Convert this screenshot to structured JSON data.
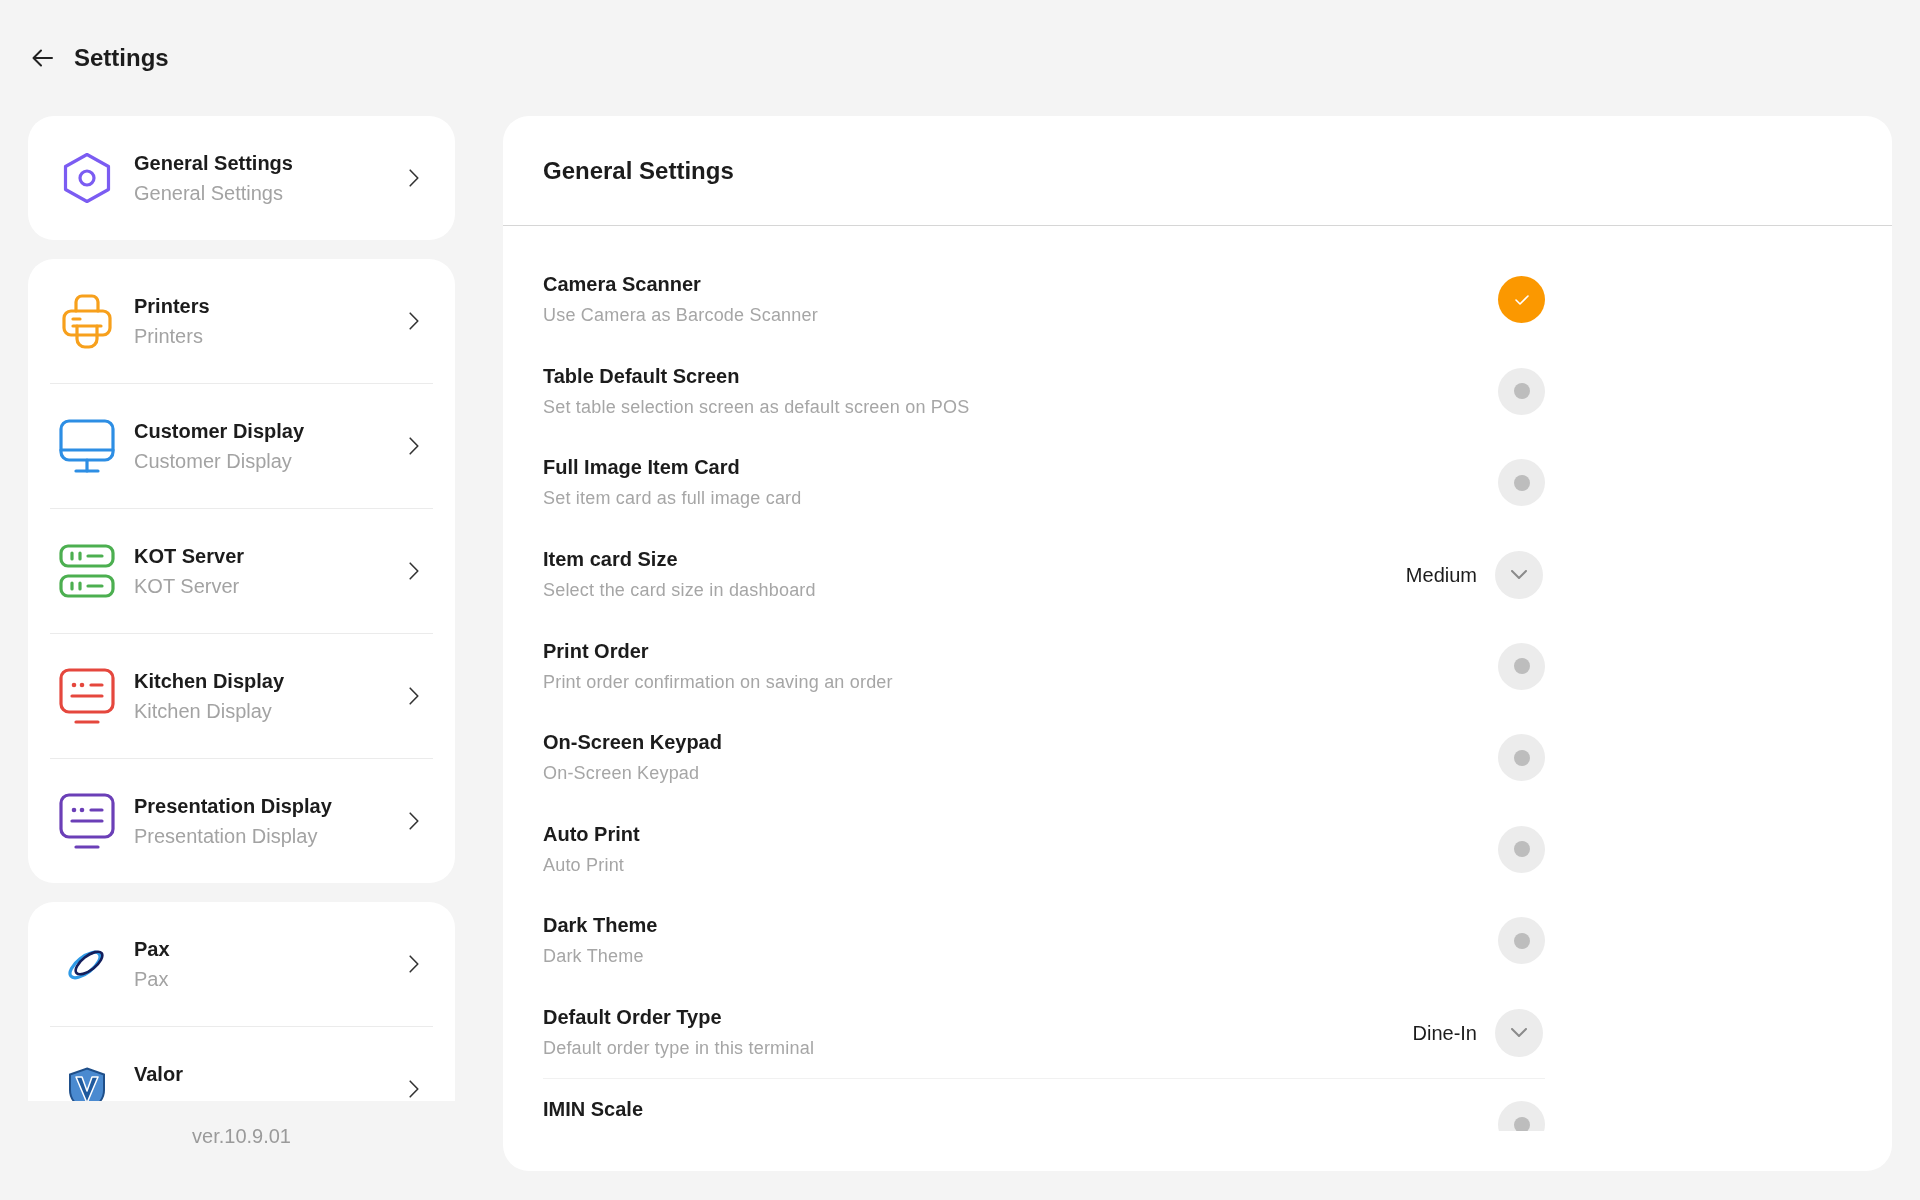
{
  "header": {
    "title": "Settings"
  },
  "sidebar": {
    "groups": [
      {
        "items": [
          {
            "title": "General Settings",
            "subtitle": "General Settings"
          }
        ]
      },
      {
        "items": [
          {
            "title": "Printers",
            "subtitle": "Printers"
          },
          {
            "title": "Customer Display",
            "subtitle": "Customer Display"
          },
          {
            "title": "KOT Server",
            "subtitle": "KOT Server"
          },
          {
            "title": "Kitchen Display",
            "subtitle": "Kitchen Display"
          },
          {
            "title": "Presentation Display",
            "subtitle": "Presentation Display"
          }
        ]
      },
      {
        "items": [
          {
            "title": "Pax",
            "subtitle": "Pax"
          },
          {
            "title": "Valor"
          }
        ]
      }
    ],
    "version": "ver.10.9.01"
  },
  "panel": {
    "title": "General Settings",
    "settings": [
      {
        "kind": "toggle",
        "title": "Camera Scanner",
        "description": "Use Camera as Barcode Scanner",
        "on": true
      },
      {
        "kind": "toggle",
        "title": "Table Default Screen",
        "description": "Set table selection screen as default screen on POS",
        "on": false
      },
      {
        "kind": "toggle",
        "title": "Full Image Item Card",
        "description": "Set item card as full image card",
        "on": false
      },
      {
        "kind": "select",
        "title": "Item card Size",
        "description": "Select the card size in dashboard",
        "value": "Medium"
      },
      {
        "kind": "toggle",
        "title": "Print Order",
        "description": "Print order confirmation on saving an order",
        "on": false
      },
      {
        "kind": "toggle",
        "title": "On-Screen Keypad",
        "description": "On-Screen Keypad",
        "on": false
      },
      {
        "kind": "toggle",
        "title": "Auto Print",
        "description": "Auto Print",
        "on": false
      },
      {
        "kind": "toggle",
        "title": "Dark Theme",
        "description": "Dark Theme",
        "on": false
      },
      {
        "kind": "select",
        "title": "Default Order Type",
        "description": "Default order type in this terminal",
        "value": "Dine-In"
      },
      {
        "kind": "toggle",
        "title": "IMIN Scale",
        "on": false
      }
    ]
  }
}
